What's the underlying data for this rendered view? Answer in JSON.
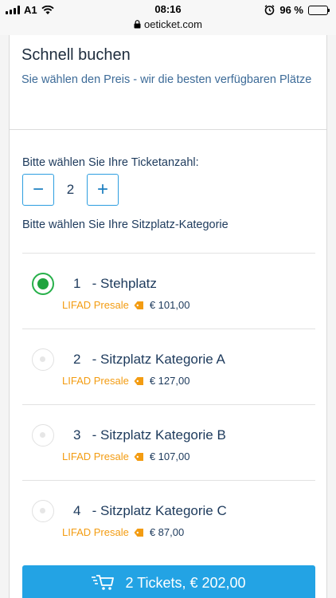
{
  "status": {
    "carrier": "A1",
    "time": "08:16",
    "url": "oeticket.com",
    "battery": "96 %"
  },
  "header": {
    "title": "Schnell buchen",
    "subtitle": "Sie wählen den Preis - wir die besten verfügbaren Plätze"
  },
  "quantity": {
    "label": "Bitte wählen Sie Ihre Ticketanzahl:",
    "minus": "−",
    "value": "2",
    "plus": "+"
  },
  "category_label": "Bitte wählen Sie Ihre Sitzplatz-Kategorie",
  "options": [
    {
      "title": "1   - Stehplatz",
      "presale": "LIFAD Presale",
      "price": "€ 101,00",
      "selected": true
    },
    {
      "title": "2   - Sitzplatz Kategorie A",
      "presale": "LIFAD Presale",
      "price": "€ 127,00",
      "selected": false
    },
    {
      "title": "3   - Sitzplatz Kategorie B",
      "presale": "LIFAD Presale",
      "price": "€ 107,00",
      "selected": false
    },
    {
      "title": "4   - Sitzplatz Kategorie C",
      "presale": "LIFAD Presale",
      "price": "€ 87,00",
      "selected": false
    }
  ],
  "cta": {
    "label": "2 Tickets, € 202,00"
  },
  "colors": {
    "accent": "#23a3e4",
    "selected": "#1fa33e",
    "presale": "#f39c12",
    "text": "#1d3a5c"
  },
  "icons": {
    "cart": "cart-icon",
    "tag": "tag-icon",
    "lock": "lock-icon",
    "wifi": "wifi-icon",
    "alarm": "alarm-icon"
  }
}
